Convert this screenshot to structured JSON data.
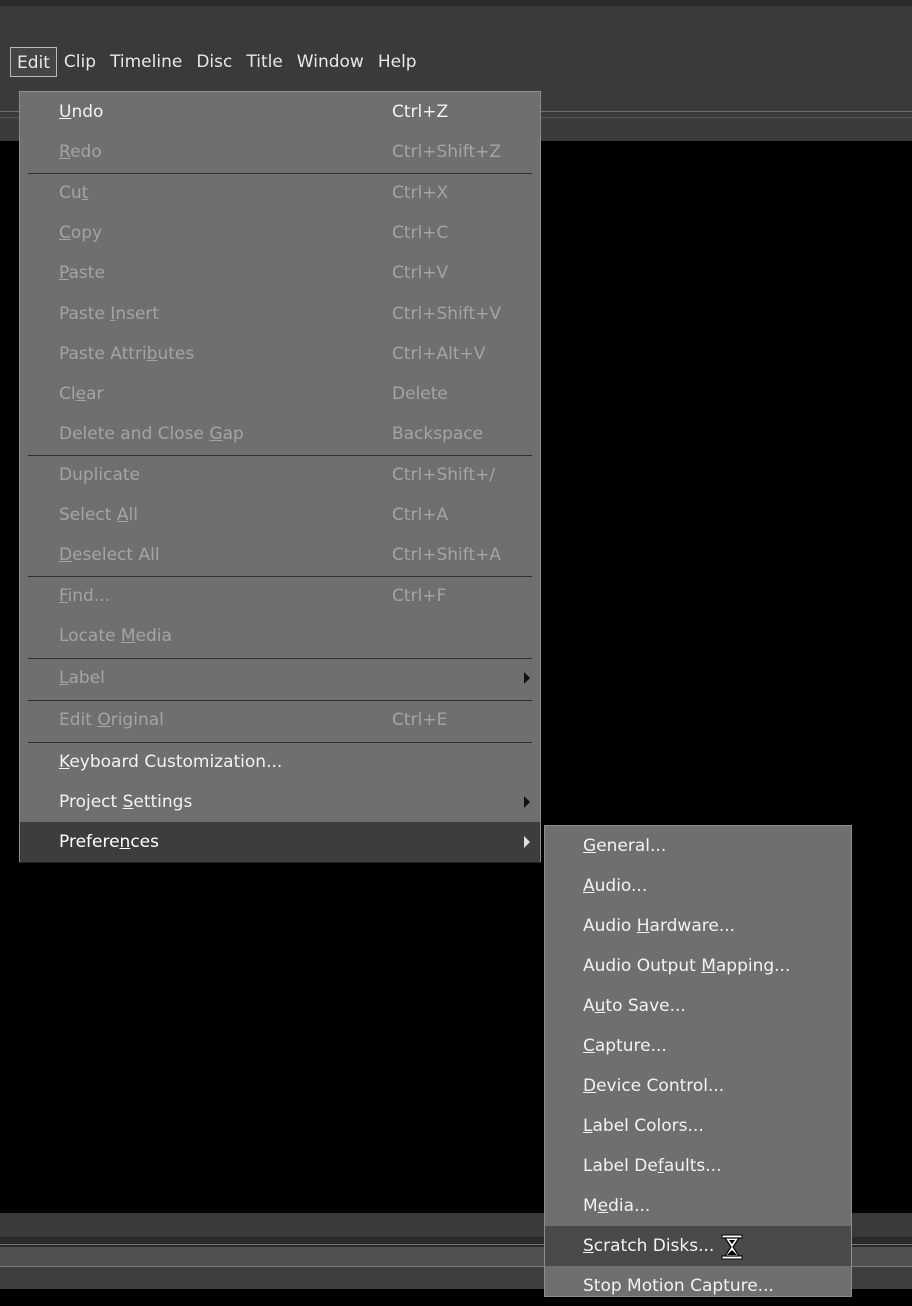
{
  "menubar": {
    "items": [
      {
        "label": "Edit",
        "active": true
      },
      {
        "label": "Clip"
      },
      {
        "label": "Timeline"
      },
      {
        "label": "Disc"
      },
      {
        "label": "Title"
      },
      {
        "label": "Window"
      },
      {
        "label": "Help"
      }
    ]
  },
  "edit_menu": {
    "items": [
      {
        "pre": "",
        "ul": "U",
        "post": "ndo",
        "shortcut": "Ctrl+Z",
        "enabled": true
      },
      {
        "pre": "",
        "ul": "R",
        "post": "edo",
        "shortcut": "Ctrl+Shift+Z",
        "enabled": false
      },
      {
        "pre": "Cu",
        "ul": "t",
        "post": "",
        "shortcut": "Ctrl+X",
        "enabled": false
      },
      {
        "pre": "",
        "ul": "C",
        "post": "opy",
        "shortcut": "Ctrl+C",
        "enabled": false
      },
      {
        "pre": "",
        "ul": "P",
        "post": "aste",
        "shortcut": "Ctrl+V",
        "enabled": false
      },
      {
        "pre": "Paste ",
        "ul": "I",
        "post": "nsert",
        "shortcut": "Ctrl+Shift+V",
        "enabled": false
      },
      {
        "pre": "Paste Attri",
        "ul": "b",
        "post": "utes",
        "shortcut": "Ctrl+Alt+V",
        "enabled": false
      },
      {
        "pre": "Cl",
        "ul": "e",
        "post": "ar",
        "shortcut": "Delete",
        "enabled": false
      },
      {
        "pre": "Delete and Close ",
        "ul": "G",
        "post": "ap",
        "shortcut": "Backspace",
        "enabled": false
      },
      {
        "pre": "Duplicate",
        "ul": "",
        "post": "",
        "shortcut": "Ctrl+Shift+/",
        "enabled": false
      },
      {
        "pre": "Select ",
        "ul": "A",
        "post": "ll",
        "shortcut": "Ctrl+A",
        "enabled": false
      },
      {
        "pre": "",
        "ul": "D",
        "post": "eselect All",
        "shortcut": "Ctrl+Shift+A",
        "enabled": false
      },
      {
        "pre": "",
        "ul": "F",
        "post": "ind...",
        "shortcut": "Ctrl+F",
        "enabled": false
      },
      {
        "pre": "Locate ",
        "ul": "M",
        "post": "edia",
        "shortcut": "",
        "enabled": false
      },
      {
        "pre": "",
        "ul": "L",
        "post": "abel",
        "shortcut": "",
        "enabled": false,
        "submenu": true
      },
      {
        "pre": "Edit ",
        "ul": "O",
        "post": "riginal",
        "shortcut": "Ctrl+E",
        "enabled": false
      },
      {
        "pre": "",
        "ul": "K",
        "post": "eyboard Customization...",
        "shortcut": "",
        "enabled": true
      },
      {
        "pre": "Project ",
        "ul": "S",
        "post": "ettings",
        "shortcut": "",
        "enabled": true,
        "submenu": true
      },
      {
        "pre": "Prefere",
        "ul": "n",
        "post": "ces",
        "shortcut": "",
        "enabled": true,
        "submenu": true,
        "highlighted": true
      }
    ]
  },
  "preferences_submenu": {
    "items": [
      {
        "pre": "",
        "ul": "G",
        "post": "eneral..."
      },
      {
        "pre": "",
        "ul": "A",
        "post": "udio..."
      },
      {
        "pre": "Audio ",
        "ul": "H",
        "post": "ardware..."
      },
      {
        "pre": "Audio Output ",
        "ul": "M",
        "post": "apping..."
      },
      {
        "pre": "A",
        "ul": "u",
        "post": "to Save..."
      },
      {
        "pre": "",
        "ul": "C",
        "post": "apture..."
      },
      {
        "pre": "",
        "ul": "D",
        "post": "evice Control..."
      },
      {
        "pre": "",
        "ul": "L",
        "post": "abel Colors..."
      },
      {
        "pre": "Label De",
        "ul": "f",
        "post": "aults..."
      },
      {
        "pre": "M",
        "ul": "e",
        "post": "dia..."
      },
      {
        "pre": "",
        "ul": "S",
        "post": "cratch Disks...",
        "highlighted": true
      },
      {
        "pre": "Stop Motion Capture...",
        "ul": "",
        "post": ""
      }
    ]
  },
  "cursor": {
    "icon": "hourglass-icon"
  }
}
